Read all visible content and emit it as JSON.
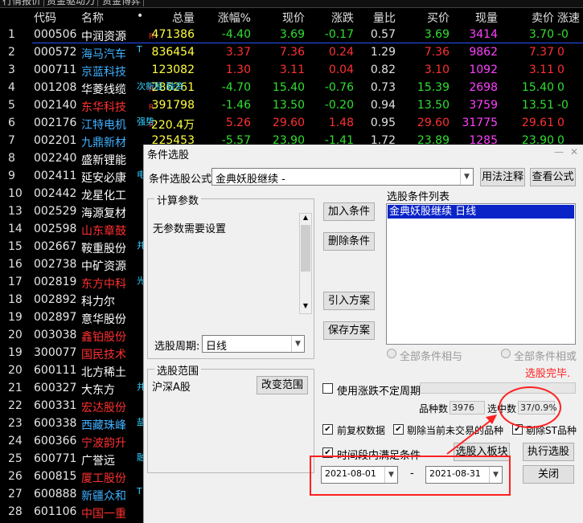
{
  "tabs": [
    "行情报价",
    "资金驱动力",
    "资金博弈"
  ],
  "columns": {
    "idx": "",
    "code": "代码",
    "name": "名称",
    "dot": "•",
    "total": "总量",
    "pct": "涨幅%",
    "price": "现价",
    "chg": "涨跌",
    "vr": "量比",
    "buy": "买价",
    "cur": "现量",
    "sell": "卖价",
    "x": "涨速"
  },
  "rows": [
    {
      "idx": "1",
      "code": "000506",
      "name": "中润资源",
      "name_color": "#ffffff",
      "r": "R",
      "total": "471386",
      "pct": "-4.40",
      "price": "3.69",
      "chg": "-0.17",
      "vr": "0.57",
      "buy": "3.69",
      "cur": "3414",
      "sell": "3.70",
      "x": "-0",
      "tone": "#30e030",
      "tag": ""
    },
    {
      "idx": "2",
      "code": "000572",
      "name": "海马汽车",
      "name_color": "#40b0ff",
      "r": "",
      "total": "836454",
      "pct": "3.37",
      "price": "7.36",
      "chg": "0.24",
      "vr": "1.29",
      "buy": "7.36",
      "cur": "9862",
      "sell": "7.37",
      "x": "0",
      "tone": "#ff3030",
      "tag": "T"
    },
    {
      "idx": "3",
      "code": "000711",
      "name": "京蓝科技",
      "name_color": "#40b0ff",
      "r": "",
      "total": "123082",
      "pct": "1.30",
      "price": "3.11",
      "chg": "0.04",
      "vr": "0.82",
      "buy": "3.10",
      "cur": "1092",
      "sell": "3.11",
      "x": "0",
      "tone": "#ff3030",
      "tag": ""
    },
    {
      "idx": "4",
      "code": "001208",
      "name": "华菱线缆",
      "name_color": "#ffffff",
      "r": "R",
      "total": "286261",
      "pct": "-4.70",
      "price": "15.40",
      "chg": "-0.76",
      "vr": "0.73",
      "buy": "15.39",
      "cur": "2698",
      "sell": "15.40",
      "x": "0",
      "tone": "#30e030",
      "tag": "次新股 融资"
    },
    {
      "idx": "5",
      "code": "002140",
      "name": "东华科技",
      "name_color": "#ff3030",
      "r": "R",
      "total": "391798",
      "pct": "-1.46",
      "price": "13.50",
      "chg": "-0.20",
      "vr": "0.94",
      "buy": "13.50",
      "cur": "3759",
      "sell": "13.51",
      "x": "-0",
      "tone": "#30e030",
      "tag": ""
    },
    {
      "idx": "6",
      "code": "002176",
      "name": "江特电机",
      "name_color": "#40b0ff",
      "r": "R",
      "total": "220.4万",
      "pct": "5.26",
      "price": "29.60",
      "chg": "1.48",
      "vr": "0.95",
      "buy": "29.60",
      "cur": "31775",
      "sell": "29.61",
      "x": "0",
      "tone": "#ff3030",
      "tag": "强势"
    },
    {
      "idx": "7",
      "code": "002201",
      "name": "九鼎新材",
      "name_color": "#40b0ff",
      "r": "",
      "total": "225453",
      "pct": "-5.57",
      "price": "23.90",
      "chg": "-1.41",
      "vr": "1.72",
      "buy": "23.89",
      "cur": "1285",
      "sell": "23.90",
      "x": "0",
      "tone": "#30e030",
      "tag": ""
    },
    {
      "idx": "8",
      "code": "002240",
      "name": "盛新锂能",
      "name_color": "#ffffff",
      "r": "",
      "total": "",
      "pct": "",
      "price": "",
      "chg": "",
      "vr": "",
      "buy": "",
      "cur": "",
      "sell": "",
      "x": "",
      "tone": "#ffffff",
      "tag": ""
    },
    {
      "idx": "9",
      "code": "002411",
      "name": "延安必康",
      "name_color": "#ffffff",
      "r": "",
      "total": "",
      "pct": "",
      "price": "",
      "chg": "",
      "vr": "",
      "buy": "",
      "cur": "",
      "sell": "",
      "x": "",
      "tone": "#ffffff",
      "tag": "电"
    },
    {
      "idx": "10",
      "code": "002442",
      "name": "龙星化工",
      "name_color": "#ffffff",
      "r": "",
      "total": "",
      "pct": "",
      "price": "",
      "chg": "",
      "vr": "",
      "buy": "",
      "cur": "",
      "sell": "",
      "x": "",
      "tone": "#ffffff",
      "tag": ""
    },
    {
      "idx": "13",
      "code": "002529",
      "name": "海源复材",
      "name_color": "#ffffff",
      "r": "",
      "total": "",
      "pct": "",
      "price": "",
      "chg": "",
      "vr": "",
      "buy": "",
      "cur": "",
      "sell": "",
      "x": "",
      "tone": "#ffffff",
      "tag": ""
    },
    {
      "idx": "14",
      "code": "002598",
      "name": "山东章鼓",
      "name_color": "#ff3030",
      "r": "",
      "total": "",
      "pct": "",
      "price": "",
      "chg": "",
      "vr": "",
      "buy": "",
      "cur": "",
      "sell": "",
      "x": "",
      "tone": "#ffffff",
      "tag": ""
    },
    {
      "idx": "15",
      "code": "002667",
      "name": "鞍重股份",
      "name_color": "#ffffff",
      "r": "",
      "total": "",
      "pct": "",
      "price": "",
      "chg": "",
      "vr": "",
      "buy": "",
      "cur": "",
      "sell": "",
      "x": "",
      "tone": "#ffffff",
      "tag": "并购"
    },
    {
      "idx": "16",
      "code": "002738",
      "name": "中矿资源",
      "name_color": "#ffffff",
      "r": "",
      "total": "",
      "pct": "",
      "price": "",
      "chg": "",
      "vr": "",
      "buy": "",
      "cur": "",
      "sell": "",
      "x": "",
      "tone": "#ffffff",
      "tag": ""
    },
    {
      "idx": "17",
      "code": "002819",
      "name": "东方中科",
      "name_color": "#ff3030",
      "r": "",
      "total": "",
      "pct": "",
      "price": "",
      "chg": "",
      "vr": "",
      "buy": "",
      "cur": "",
      "sell": "",
      "x": "",
      "tone": "#ffffff",
      "tag": "光老"
    },
    {
      "idx": "18",
      "code": "002892",
      "name": "科力尔",
      "name_color": "#ffffff",
      "r": "",
      "total": "",
      "pct": "",
      "price": "",
      "chg": "",
      "vr": "",
      "buy": "",
      "cur": "",
      "sell": "",
      "x": "",
      "tone": "#ffffff",
      "tag": ""
    },
    {
      "idx": "19",
      "code": "002897",
      "name": "意华股份",
      "name_color": "#ffffff",
      "r": "",
      "total": "",
      "pct": "",
      "price": "",
      "chg": "",
      "vr": "",
      "buy": "",
      "cur": "",
      "sell": "",
      "x": "",
      "tone": "#ffffff",
      "tag": ""
    },
    {
      "idx": "20",
      "code": "003038",
      "name": "鑫铂股份",
      "name_color": "#ff3030",
      "r": "",
      "total": "",
      "pct": "",
      "price": "",
      "chg": "",
      "vr": "",
      "buy": "",
      "cur": "",
      "sell": "",
      "x": "",
      "tone": "#ffffff",
      "tag": ""
    },
    {
      "idx": "19",
      "code": "300077",
      "name": "国民技术",
      "name_color": "#ff3030",
      "r": "",
      "total": "",
      "pct": "",
      "price": "",
      "chg": "",
      "vr": "",
      "buy": "",
      "cur": "",
      "sell": "",
      "x": "",
      "tone": "#ffffff",
      "tag": ""
    },
    {
      "idx": "20",
      "code": "600111",
      "name": "北方稀土",
      "name_color": "#ffffff",
      "r": "",
      "total": "",
      "pct": "",
      "price": "",
      "chg": "",
      "vr": "",
      "buy": "",
      "cur": "",
      "sell": "",
      "x": "",
      "tone": "#ffffff",
      "tag": ""
    },
    {
      "idx": "21",
      "code": "600327",
      "name": "大东方",
      "name_color": "#ffffff",
      "r": "",
      "total": "",
      "pct": "",
      "price": "",
      "chg": "",
      "vr": "",
      "buy": "",
      "cur": "",
      "sell": "",
      "x": "",
      "tone": "#ffffff",
      "tag": "并购重"
    },
    {
      "idx": "22",
      "code": "600331",
      "name": "宏达股份",
      "name_color": "#ff3030",
      "r": "",
      "total": "",
      "pct": "",
      "price": "",
      "chg": "",
      "vr": "",
      "buy": "",
      "cur": "",
      "sell": "",
      "x": "",
      "tone": "#ffffff",
      "tag": ""
    },
    {
      "idx": "23",
      "code": "600338",
      "name": "西藏珠峰",
      "name_color": "#40b0ff",
      "r": "",
      "total": "",
      "pct": "",
      "price": "",
      "chg": "",
      "vr": "",
      "buy": "",
      "cur": "",
      "sell": "",
      "x": "",
      "tone": "#ffffff",
      "tag": "盐"
    },
    {
      "idx": "24",
      "code": "600366",
      "name": "宁波韵升",
      "name_color": "#ff3030",
      "r": "",
      "total": "",
      "pct": "",
      "price": "",
      "chg": "",
      "vr": "",
      "buy": "",
      "cur": "",
      "sell": "",
      "x": "",
      "tone": "#ffffff",
      "tag": ""
    },
    {
      "idx": "25",
      "code": "600771",
      "name": "广誉远",
      "name_color": "#ffffff",
      "r": "",
      "total": "",
      "pct": "",
      "price": "",
      "chg": "",
      "vr": "",
      "buy": "",
      "cur": "",
      "sell": "",
      "x": "",
      "tone": "#ffffff",
      "tag": "融资"
    },
    {
      "idx": "26",
      "code": "600815",
      "name": "厦工股份",
      "name_color": "#ff3030",
      "r": "",
      "total": "",
      "pct": "",
      "price": "",
      "chg": "",
      "vr": "",
      "buy": "",
      "cur": "",
      "sell": "",
      "x": "",
      "tone": "#ffffff",
      "tag": ""
    },
    {
      "idx": "27",
      "code": "600888",
      "name": "新疆众和",
      "name_color": "#40b0ff",
      "r": "R",
      "total": "695559",
      "pct": "-3.67",
      "price": "10.50",
      "chg": "-0.40",
      "vr": "0.56",
      "buy": "10.50",
      "cur": "7636",
      "sell": "10.50",
      "x": "0",
      "tone": "#30e030",
      "tag": "T"
    },
    {
      "idx": "28",
      "code": "601106",
      "name": "中国一重",
      "name_color": "#ff3030",
      "r": "R",
      "total": "106.6万",
      "pct": "0.49",
      "price": "4.10",
      "chg": "0.02",
      "vr": "0.77",
      "buy": "4.10",
      "cur": "13180",
      "sell": "4.11",
      "x": "0",
      "tone": "#ff3030",
      "tag": ""
    }
  ],
  "dialog": {
    "title": "条件选股",
    "formula_label": "条件选股公式",
    "formula_value": "金典妖股继续 -",
    "usage_btn": "用法注释",
    "view_formula_btn": "查看公式",
    "params_group": "计算参数",
    "params_text": "无参数需要设置",
    "add_btn": "加入条件",
    "delete_btn": "删除条件",
    "import_btn": "引入方案",
    "save_btn": "保存方案",
    "list_label": "选股条件列表",
    "list_items": [
      "金典妖股继续  日线"
    ],
    "radio_and": "全部条件相与",
    "radio_or": "全部条件相或",
    "status": "选股完毕.",
    "period_label": "选股周期:",
    "period_value": "日线",
    "range_group": "选股范围",
    "range_value": "沪深A股",
    "change_range_btn": "改变范围",
    "use_range_label": "使用涨跌不定周期",
    "count_label": "品种数",
    "count_value": "3976",
    "selected_label": "选中数",
    "selected_value": "37/0.9%",
    "pre_adj_label": "前复权数据",
    "exclude_untraded_label": "剔除当前未交易的品种",
    "exclude_st_label": "剔除ST品种",
    "time_range_label": "时间段内满足条件",
    "select_to_board_btn": "选股入板块",
    "execute_btn": "执行选股",
    "date_start": "2021-08-01",
    "date_sep": "-",
    "date_end": "2021-08-31",
    "close_btn": "关闭",
    "min_icon": "—",
    "close_icon": "✕"
  },
  "colors": {
    "up": "#ff3030",
    "down": "#30e030",
    "annotation": "#ff2020"
  }
}
